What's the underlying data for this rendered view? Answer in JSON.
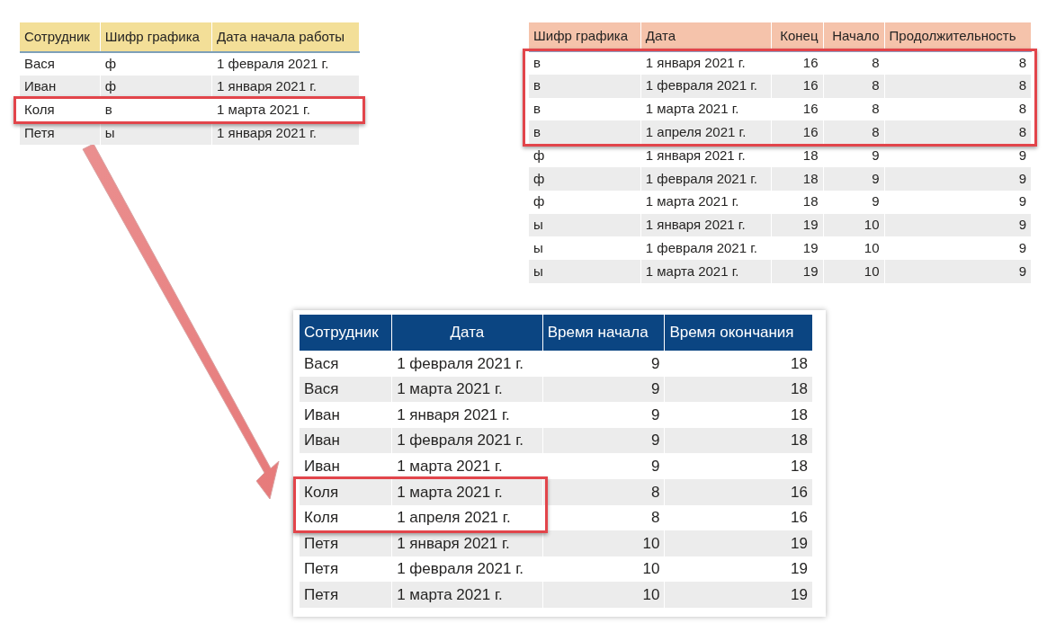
{
  "tables": [
    {
      "columns": [
        {
          "label": "Сотрудник",
          "kind": "text"
        },
        {
          "label": "Шифр графика",
          "kind": "text"
        },
        {
          "label": "Дата начала работы",
          "kind": "text"
        }
      ],
      "sections": [
        {
          "framed": false,
          "rows": [
            [
              "Вася",
              "ф",
              "1 февраля 2021 г."
            ],
            [
              "Иван",
              "ф",
              "1 января 2021 г."
            ]
          ]
        },
        {
          "framed": true,
          "rows": [
            [
              "Коля",
              "в",
              "1 марта 2021 г."
            ]
          ]
        },
        {
          "framed": false,
          "rows": [
            [
              "Петя",
              "ы",
              "1 января 2021 г."
            ]
          ]
        }
      ]
    },
    {
      "columns": [
        {
          "label": "Шифр графика",
          "kind": "text"
        },
        {
          "label": "Дата",
          "kind": "text"
        },
        {
          "label": "Конец",
          "kind": "number"
        },
        {
          "label": "Начало",
          "kind": "number"
        },
        {
          "label": "Продолжительность",
          "kind": "number"
        }
      ],
      "sections": [
        {
          "framed": true,
          "rows": [
            [
              "в",
              "1 января 2021 г.",
              "16",
              "8",
              "8"
            ],
            [
              "в",
              "1 февраля 2021 г.",
              "16",
              "8",
              "8"
            ],
            [
              "в",
              "1 марта 2021 г.",
              "16",
              "8",
              "8"
            ],
            [
              "в",
              "1 апреля 2021 г.",
              "16",
              "8",
              "8"
            ]
          ]
        },
        {
          "framed": false,
          "rows": [
            [
              "ф",
              "1 января 2021 г.",
              "18",
              "9",
              "9"
            ],
            [
              "ф",
              "1 февраля 2021 г.",
              "18",
              "9",
              "9"
            ],
            [
              "ф",
              "1 марта 2021 г.",
              "18",
              "9",
              "9"
            ],
            [
              "ы",
              "1 января 2021 г.",
              "19",
              "10",
              "9"
            ],
            [
              "ы",
              "1 февраля 2021 г.",
              "19",
              "10",
              "9"
            ],
            [
              "ы",
              "1 марта 2021 г.",
              "19",
              "10",
              "9"
            ]
          ]
        }
      ]
    },
    {
      "columns": [
        {
          "label": "Сотрудник",
          "kind": "text"
        },
        {
          "label": "Дата",
          "kind": "text"
        },
        {
          "label": "Время начала",
          "kind": "number"
        },
        {
          "label": "Время окончания",
          "kind": "number"
        }
      ],
      "sections": [
        {
          "framed": false,
          "rows": [
            [
              "Вася",
              "1 февраля 2021 г.",
              "9",
              "18"
            ],
            [
              "Вася",
              "1 марта 2021 г.",
              "9",
              "18"
            ],
            [
              "Иван",
              "1 января 2021 г.",
              "9",
              "18"
            ],
            [
              "Иван",
              "1 февраля 2021 г.",
              "9",
              "18"
            ],
            [
              "Иван",
              "1 марта 2021 г.",
              "9",
              "18"
            ]
          ]
        },
        {
          "framed": true,
          "rows": [
            [
              "Коля",
              "1 марта 2021 г.",
              "8",
              "16"
            ],
            [
              "Коля",
              "1 апреля 2021 г.",
              "8",
              "16"
            ]
          ]
        },
        {
          "framed": false,
          "rows": [
            [
              "Петя",
              "1 января 2021 г.",
              "10",
              "19"
            ],
            [
              "Петя",
              "1 февраля 2021 г.",
              "10",
              "19"
            ],
            [
              "Петя",
              "1 марта 2021 г.",
              "10",
              "19"
            ]
          ]
        }
      ]
    }
  ]
}
